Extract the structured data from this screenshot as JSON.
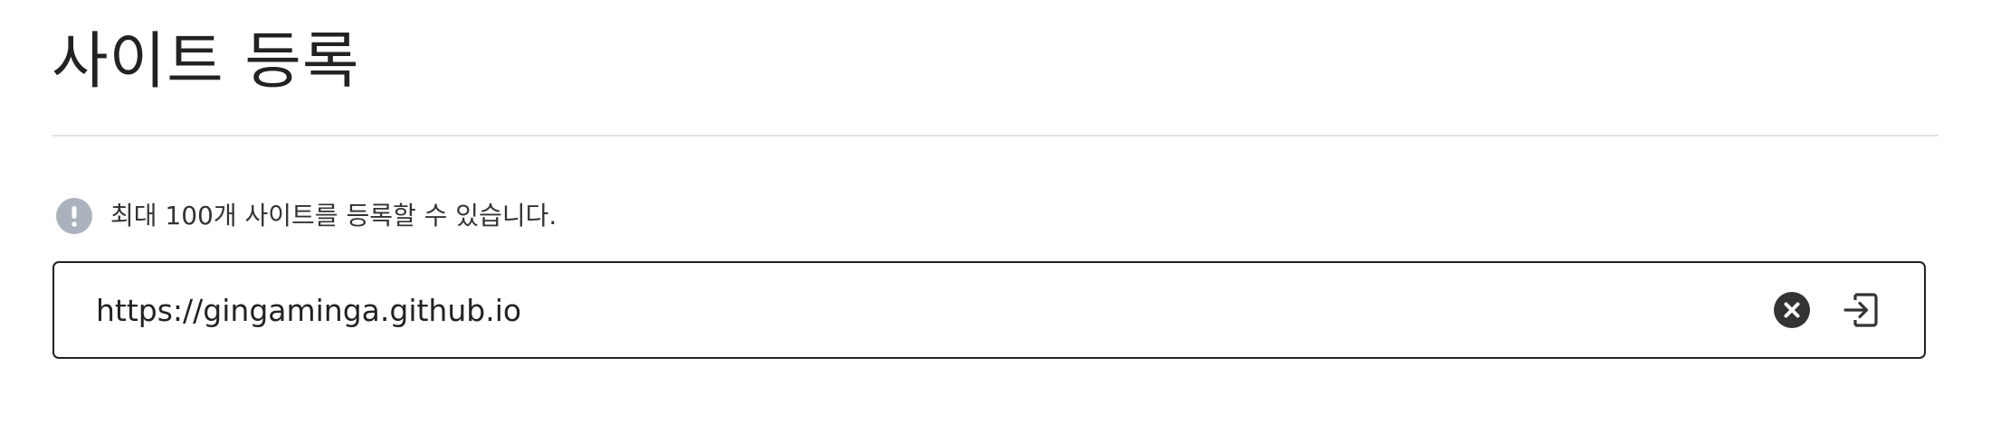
{
  "header": {
    "title": "사이트 등록"
  },
  "notice": {
    "icon": "exclamation-icon",
    "text": "최대 100개 사이트를 등록할 수 있습니다."
  },
  "url_field": {
    "value": "https://gingaminga.github.io",
    "clear_icon": "clear-icon",
    "submit_icon": "enter-icon"
  },
  "colors": {
    "notice_icon_bg": "#a9b2bd",
    "border": "#222222",
    "divider": "#e2e2e2"
  }
}
